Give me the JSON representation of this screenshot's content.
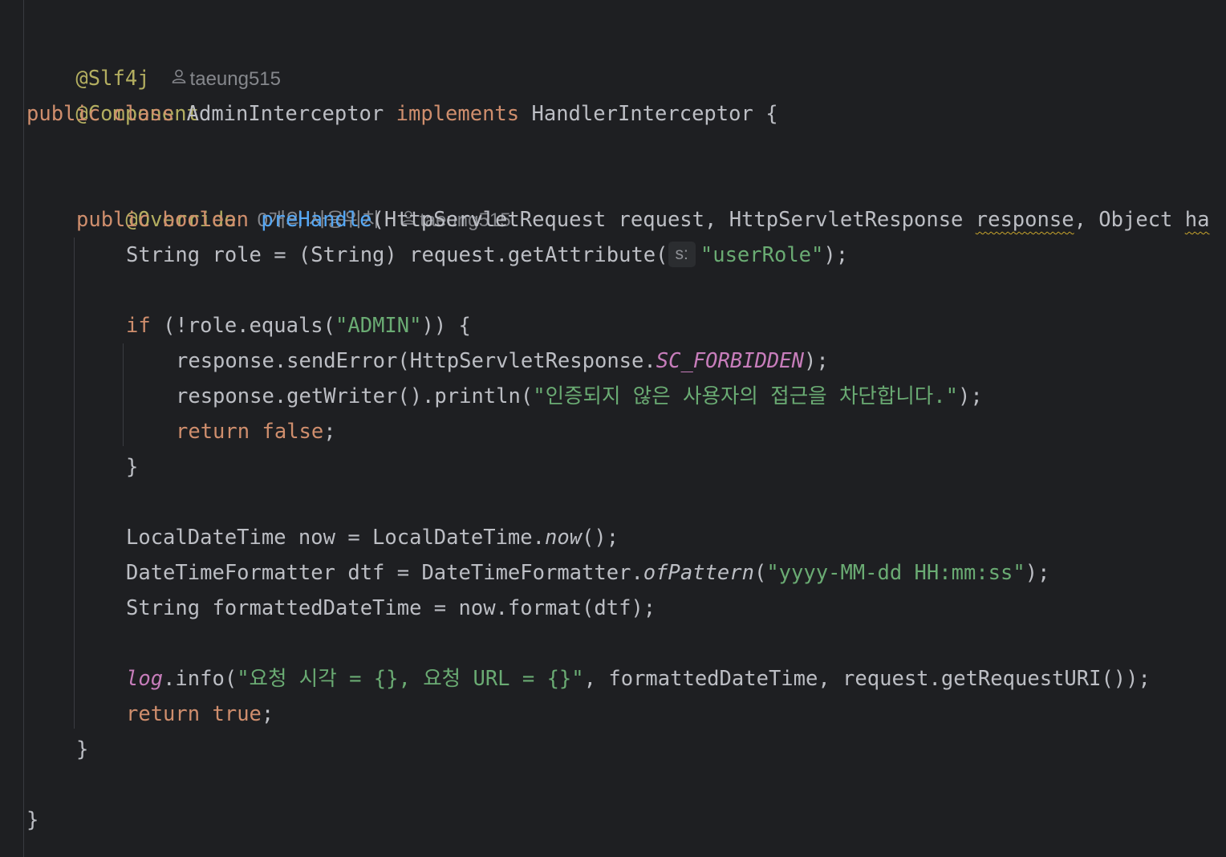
{
  "editor": {
    "author_name": "taeung515",
    "usages_label": "0개의 사용위치",
    "param_hint": "s:",
    "lines": {
      "l1_annotation": "@Slf4j",
      "l2_annotation": "@Component",
      "l3_public": "public",
      "l3_class": "class",
      "l3_name": "AdminInterceptor",
      "l3_implements": "implements",
      "l3_interface": "HandlerInterceptor {",
      "l5_override": "@Override",
      "l6_public": "public",
      "l6_boolean": "boolean",
      "l6_method": "preHandle",
      "l6_params_a": "(HttpServletRequest request, HttpServletResponse ",
      "l6_response": "response",
      "l6_params_b": ", Object ",
      "l6_handler": "ha",
      "l7_code": "String role = (String) request.getAttribute(",
      "l7_str": "\"userRole\"",
      "l7_end": ");",
      "l9_if": "if",
      "l9_code": " (!role.equals(",
      "l9_str": "\"ADMIN\"",
      "l9_end": ")) {",
      "l10_code": "response.sendError(HttpServletResponse.",
      "l10_const": "SC_FORBIDDEN",
      "l10_end": ");",
      "l11_code": "response.getWriter().println(",
      "l11_str": "\"인증되지 않은 사용자의 접근을 차단합니다.\"",
      "l11_end": ");",
      "l12_return": "return",
      "l12_false": "false",
      "l12_end": ";",
      "l13_brace": "}",
      "l15_code": "LocalDateTime now = LocalDateTime.",
      "l15_now": "now",
      "l15_end": "();",
      "l16_code": "DateTimeFormatter dtf = DateTimeFormatter.",
      "l16_of": "ofPattern",
      "l16_open": "(",
      "l16_str": "\"yyyy-MM-dd HH:mm:ss\"",
      "l16_end": ");",
      "l17_code": "String formattedDateTime = now.format(dtf);",
      "l19_log": "log",
      "l19_info": ".info(",
      "l19_str": "\"요청 시각 = {}, 요청 URL = {}\"",
      "l19_end": ", formattedDateTime, request.getRequestURI());",
      "l20_return": "return",
      "l20_true": "true",
      "l20_end": ";",
      "l21_brace": "}",
      "l23_brace": "}"
    }
  },
  "colors": {
    "background": "#1e1f22",
    "keyword": "#cf8e6d",
    "annotation": "#b3ae60",
    "function": "#56a8f5",
    "string": "#6aab73",
    "static_field": "#c77dbb",
    "default_text": "#bcbec4",
    "hint": "#85878c"
  }
}
